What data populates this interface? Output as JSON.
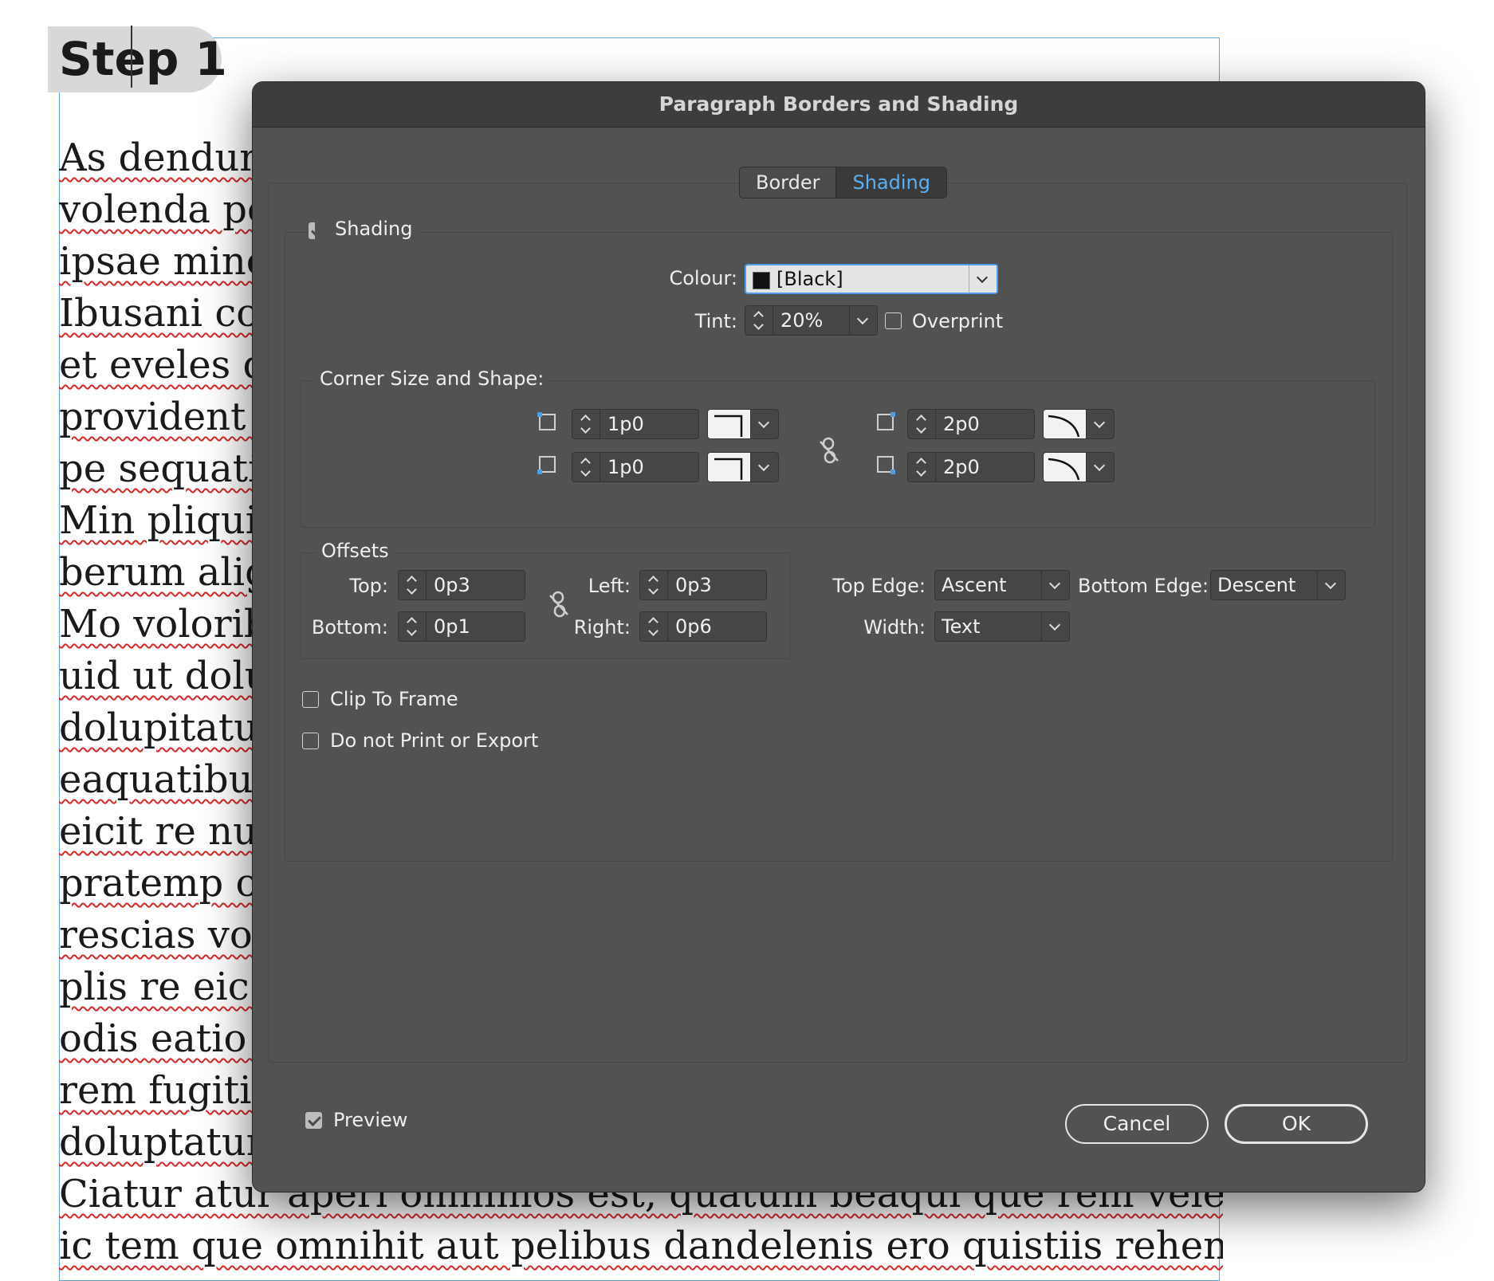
{
  "document": {
    "step_title": "Step 1",
    "lines": [
      "As dendunt",
      "volenda per",
      "ipsae minci",
      "Ibusani con",
      "et eveles do",
      "provident a",
      "pe sequatia",
      "Min pliqui",
      "berum alig",
      "Mo volorib",
      "uid ut dolu",
      "dolupitatur",
      "eaquatibusa",
      "eicit re nun",
      "pratemp or",
      "rescias vole",
      "plis re eic te",
      "odis eatio e",
      "rem fugitist",
      "doluptatur",
      "Ciatur atur aperi omnimos est, quatum beaqui que rem velest mod-",
      "ic tem que omnihit aut pelibus dandelenis ero quistiis rehenecto"
    ]
  },
  "dialog": {
    "title": "Paragraph Borders and Shading",
    "tabs": [
      {
        "label": "Border",
        "active": false
      },
      {
        "label": "Shading",
        "active": true
      }
    ],
    "shading": {
      "enabled_label": "Shading",
      "enabled": true,
      "colour_label": "Colour:",
      "colour_value": "[Black]",
      "colour_swatch": "#111111",
      "tint_label": "Tint:",
      "tint_value": "20%",
      "overprint_label": "Overprint",
      "overprint": false
    },
    "corners": {
      "section_label": "Corner Size and Shape:",
      "top_left_size": "1p0",
      "bottom_left_size": "1p0",
      "top_right_size": "2p0",
      "bottom_right_size": "2p0",
      "top_left_icon": "corner-top-left-icon",
      "bottom_left_icon": "corner-bottom-left-icon",
      "top_right_icon": "corner-top-right-icon",
      "bottom_right_icon": "corner-bottom-right-icon",
      "link_icon": "broken-link-icon"
    },
    "offsets": {
      "section_label": "Offsets",
      "top_label": "Top:",
      "top_value": "0p3",
      "bottom_label": "Bottom:",
      "bottom_value": "0p1",
      "left_label": "Left:",
      "left_value": "0p3",
      "right_label": "Right:",
      "right_value": "0p6",
      "link_icon": "broken-link-icon"
    },
    "edges": {
      "top_edge_label": "Top Edge:",
      "top_edge_value": "Ascent",
      "bottom_edge_label": "Bottom Edge:",
      "bottom_edge_value": "Descent",
      "width_label": "Width:",
      "width_value": "Text"
    },
    "options": {
      "clip_to_frame_label": "Clip To Frame",
      "clip_to_frame": false,
      "do_not_print_label": "Do not Print or Export",
      "do_not_print": false
    },
    "footer": {
      "preview_label": "Preview",
      "preview": true,
      "cancel_label": "Cancel",
      "ok_label": "OK"
    }
  },
  "colors": {
    "dialog_bg": "#525252",
    "titlebar_bg": "#3d3d3d",
    "active_tab_text": "#5ab0f7",
    "focus_ring": "#4c9ce8",
    "frame_guide": "#5aa8dd",
    "spell_underline": "#d62828"
  }
}
